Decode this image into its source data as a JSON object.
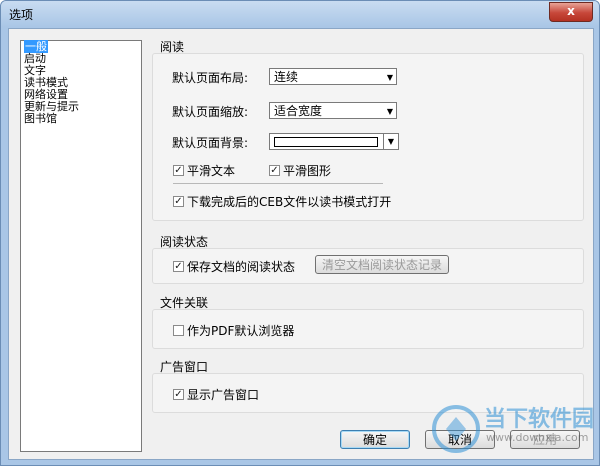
{
  "window": {
    "title": "选项",
    "close_glyph": "x"
  },
  "nav": {
    "items": [
      "一般",
      "启动",
      "文字",
      "读书模式",
      "网络设置",
      "更新与提示",
      "图书馆"
    ],
    "selected_index": 0
  },
  "reading": {
    "group_title": "阅读",
    "layout_label": "默认页面布局:",
    "layout_value": "连续",
    "zoom_label": "默认页面缩放:",
    "zoom_value": "适合宽度",
    "bg_label": "默认页面背景:",
    "bg_color": "#ffffff",
    "smooth_text_label": "平滑文本",
    "smooth_text_checked": true,
    "smooth_image_label": "平滑图形",
    "smooth_image_checked": true,
    "ceb_label": "下载完成后的CEB文件以读书模式打开",
    "ceb_checked": true
  },
  "reading_state": {
    "group_title": "阅读状态",
    "save_label": "保存文档的阅读状态",
    "save_checked": true,
    "clear_button": "清空文档阅读状态记录"
  },
  "file_assoc": {
    "group_title": "文件关联",
    "default_pdf_label": "作为PDF默认浏览器",
    "default_pdf_checked": false
  },
  "ad": {
    "group_title": "广告窗口",
    "show_ad_label": "显示广告窗口",
    "show_ad_checked": true
  },
  "buttons": {
    "ok": "确定",
    "cancel": "取消",
    "apply": "应用"
  },
  "watermark": {
    "brand": "当下软件园",
    "url": "www.downxia.com"
  },
  "colors": {
    "title_bar": "#a9c6e6",
    "close_button": "#c7473a",
    "selection": "#3399ff",
    "watermark": "#2d8fd5"
  }
}
